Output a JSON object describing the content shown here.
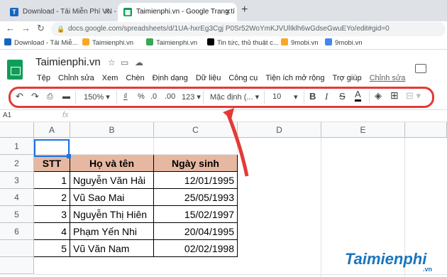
{
  "browser": {
    "tabs": [
      {
        "label": "Download - Tải Miễn Phí VN - Ph"
      },
      {
        "label": "Taimienphi.vn - Google Trang tí"
      }
    ],
    "url": "docs.google.com/spreadsheets/d/1UA-hxrEg3Cgj P0Sr52WoYmKJVUlIklh6wGdseGwuEYo/edit#gid=0",
    "bookmarks": [
      {
        "label": "Download - Tải Miễ...",
        "color": "#1565c0"
      },
      {
        "label": "Taimienphi.vn",
        "color": "#f9a825"
      },
      {
        "label": "Taimienphi.vn",
        "color": "#34a853"
      },
      {
        "label": "Tin tức, thủ thuật c...",
        "color": "#000000"
      },
      {
        "label": "9mobi.vn",
        "color": "#f9a825"
      },
      {
        "label": "9mobi.vn",
        "color": "#4285f4"
      }
    ]
  },
  "doc": {
    "title": "Taimienphi.vn"
  },
  "menu": [
    "Tệp",
    "Chỉnh sửa",
    "Xem",
    "Chèn",
    "Định dạng",
    "Dữ liệu",
    "Công cụ",
    "Tiện ích mở rộng",
    "Trợ giúp"
  ],
  "menu_last": "Chỉnh sửa",
  "toolbar": {
    "zoom": "150%",
    "currency": "₫",
    "percent": "%",
    "dec_less": ".0",
    "dec_more": ".00",
    "format_more": "123",
    "font": "Mặc định (...",
    "size": "10",
    "bold": "B",
    "italic": "I",
    "strike": "S",
    "color": "A"
  },
  "formula": {
    "ref": "A1",
    "fx": "fx"
  },
  "columns": [
    "A",
    "B",
    "C",
    "D",
    "E"
  ],
  "rows": [
    "1",
    "2",
    "3",
    "4",
    "5",
    "6"
  ],
  "table": {
    "headers": [
      "STT",
      "Họ và tên",
      "Ngày sinh"
    ],
    "rows": [
      [
        "1",
        "Nguyễn Văn Hải",
        "12/01/1995"
      ],
      [
        "2",
        "Vũ Sao Mai",
        "25/05/1993"
      ],
      [
        "3",
        "Nguyễn Thị Hiên",
        "15/02/1997"
      ],
      [
        "4",
        "Phạm Yến Nhi",
        "20/04/1995"
      ],
      [
        "5",
        "Vũ Văn Nam",
        "02/02/1998"
      ]
    ]
  },
  "watermark": {
    "text": "Taimienphi",
    "suffix": ".vn"
  }
}
